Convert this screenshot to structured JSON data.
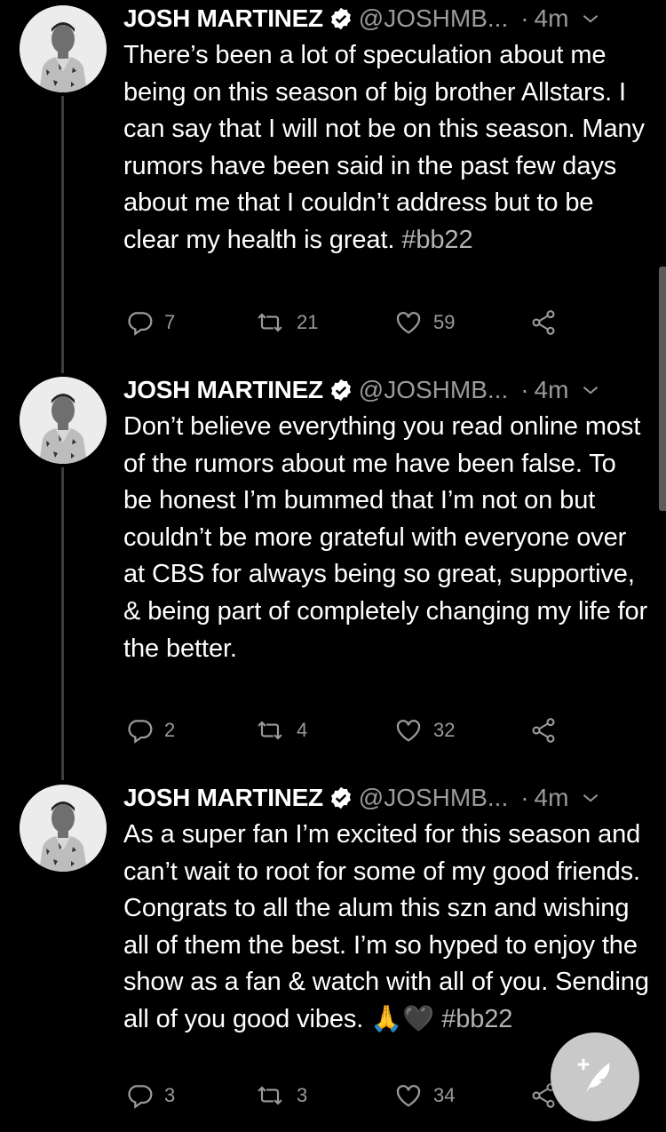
{
  "tweets": [
    {
      "author_name": "JOSH MARTINEZ",
      "handle": "@JOSHMB...",
      "time": "4m",
      "text": "There’s been a lot of speculation about me being on this season of big brother Allstars. I can say that I will not be on this season. Many rumors have been said in the past few days about me that I couldn’t address but to be clear my health is great. ",
      "hashtag": "#bb22",
      "replies": "7",
      "retweets": "21",
      "likes": "59"
    },
    {
      "author_name": "JOSH MARTINEZ",
      "handle": "@JOSHMB...",
      "time": "4m",
      "text": "Don’t believe everything you read online most of the rumors about me have been false. To be honest I’m bummed that I’m not on but couldn’t be more grateful with everyone over at CBS for always being so great, supportive, & being part of completely changing my life for the better.",
      "hashtag": "",
      "replies": "2",
      "retweets": "4",
      "likes": "32"
    },
    {
      "author_name": "JOSH MARTINEZ",
      "handle": "@JOSHMB...",
      "time": "4m",
      "text": "As a super fan I’m excited for this season and can’t wait to root for some of my good friends. Congrats to all the alum this szn and wishing all of them the best. I’m so hyped to enjoy the show as a fan & watch with all of you. Sending all of you good vibes. 🙏🖤 ",
      "hashtag": "#bb22",
      "replies": "3",
      "retweets": "3",
      "likes": "34"
    }
  ],
  "icons": {
    "verified": "verified-badge-icon",
    "caret": "chevron-down-icon",
    "reply": "reply-icon",
    "retweet": "retweet-icon",
    "like": "heart-icon",
    "share": "share-icon",
    "compose": "compose-tweet-icon"
  },
  "colors": {
    "background": "#000000",
    "text": "#ffffff",
    "muted": "#9a9a9a",
    "fab": "#c9c9c9"
  }
}
